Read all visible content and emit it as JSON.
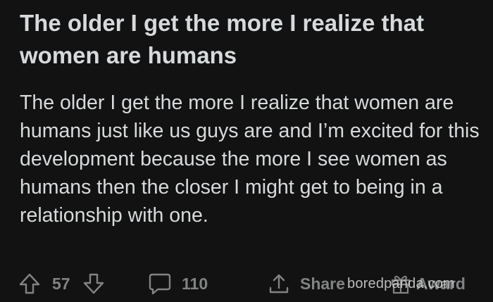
{
  "post": {
    "title": "The older I get the more I realize that women are humans",
    "body": "The older I get the more I realize that women are humans just like us guys are and I’m excited for this development because the more I see women as humans then the closer I might get to being in a relationship with one."
  },
  "actions": {
    "score": "57",
    "comments_count": "110",
    "share_label": "Share",
    "award_label": "Award",
    "upvote_icon": "arrow-up-icon",
    "downvote_icon": "arrow-down-icon",
    "comment_icon": "speech-bubble-icon",
    "share_icon": "share-upload-icon",
    "award_icon": "gift-icon"
  },
  "watermark": {
    "text": "boredpanda.com"
  },
  "colors": {
    "background": "#121212",
    "text": "#d7dadc",
    "muted": "#818384"
  }
}
